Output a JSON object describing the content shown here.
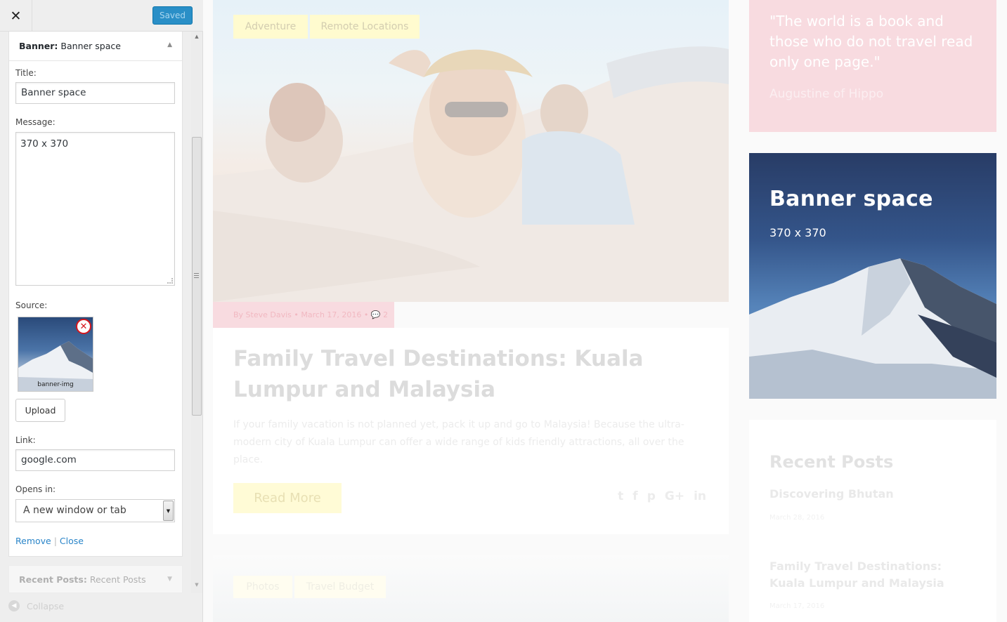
{
  "topbar": {
    "close_glyph": "✕",
    "saved_label": "Saved"
  },
  "widget": {
    "type_label": "Banner:",
    "name": "Banner space",
    "collapse_glyph": "▲",
    "title_label": "Title:",
    "title_value": "Banner space",
    "message_label": "Message:",
    "message_value": "370 x 370",
    "source_label": "Source:",
    "image_name": "banner-img",
    "remove_image_glyph": "✕",
    "upload_label": "Upload",
    "link_label": "Link:",
    "link_value": "google.com",
    "opens_label": "Opens in:",
    "opens_value": "A new window or tab",
    "remove_label": "Remove",
    "separator": "|",
    "close_label": "Close"
  },
  "widget2": {
    "type_label": "Recent Posts:",
    "name": "Recent Posts",
    "expand_glyph": "▼"
  },
  "collapse_label": "Collapse",
  "preview": {
    "tags": [
      "Adventure",
      "Remote Locations"
    ],
    "meta": "By Steve Davis • March 17, 2016 • 💬 2",
    "post_title": "Family Travel Destinations: Kuala Lumpur and Malaysia",
    "post_excerpt": "If your family vacation is not planned yet, pack it up and go to Malaysia! Because the ultra-modern city of Kuala Lumpur can offer a wide range of kids friendly attractions, all over the place.",
    "read_more": "Read More",
    "share_icons": [
      "twitter-icon",
      "facebook-icon",
      "pinterest-icon",
      "google-plus-icon",
      "linkedin-icon"
    ],
    "share_glyphs": [
      "t",
      "f",
      "p",
      "G+",
      "in"
    ],
    "tags2": [
      "Photos",
      "Travel Budget"
    ],
    "quote": "\"The world is a book and those who do not travel read only one page.\"",
    "quote_author": "Augustine of Hippo",
    "banner_title": "Banner space",
    "banner_message": "370 x 370",
    "recent_title": "Recent Posts",
    "recent_posts": [
      {
        "title": "Discovering Bhutan",
        "date": "March 28, 2016"
      },
      {
        "title": "Family Travel Destinations: Kuala Lumpur and Malaysia",
        "date": "March 17, 2016"
      }
    ]
  },
  "colors": {
    "saved_button": "#2a8fc7",
    "link": "#2a85c9",
    "remove_badge": "#d6161d",
    "quote_box": "#f8dbe0",
    "tag_bg": "#fffbcf",
    "banner_top": "#283c66"
  }
}
